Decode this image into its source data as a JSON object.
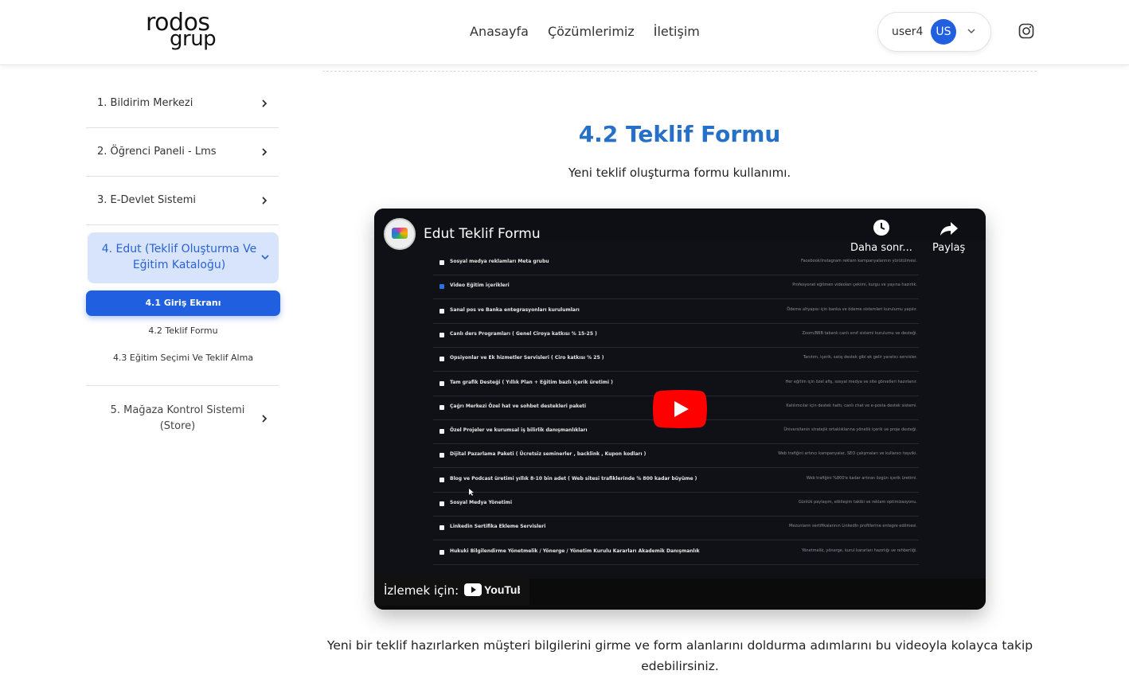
{
  "header": {
    "logo_line1": "rodos",
    "logo_line2": "grup",
    "nav": [
      "Anasayfa",
      "Çözümlerimiz",
      "İletişim"
    ],
    "user": {
      "name": "user4",
      "initials": "US"
    }
  },
  "sidebar": {
    "items": [
      {
        "label": "1. Bildirim Merkezi"
      },
      {
        "label": "2. Öğrenci Paneli - Lms"
      },
      {
        "label": "3. E-Devlet Sistemi"
      }
    ],
    "active": {
      "label": "4. Edut (Teklif Oluşturma Ve Eğitim Kataloğu)"
    },
    "subitems": [
      "4.1 Giriş Ekranı",
      "4.2 Teklif Formu",
      "4.3 Eğitim Seçimi Ve Teklif Alma"
    ],
    "last": {
      "label": "5. Mağaza Kontrol Sistemi (Store)"
    }
  },
  "main": {
    "title": "4.2 Teklif Formu",
    "subtitle": "Yeni teklif oluşturma formu kullanımı.",
    "description": "Yeni bir teklif hazırlarken müşteri bilgilerini girme ve form alanlarını doldurma adımlarını bu videoyla kolayca takip edebilirsiniz."
  },
  "video": {
    "title": "Edut Teklif Formu",
    "watch_later": "Daha sonr...",
    "share": "Paylaş",
    "watch_on": "İzlemek için:",
    "rows": [
      {
        "label": "Sosyal medya reklamları Meta grubu",
        "note": "Facebook/Instagram reklam kampanyalarının yürütülmesi.",
        "checked": false
      },
      {
        "label": "Video Eğitim içerikleri",
        "note": "Profesyonel eğitmen videoları çekimi, kurgu ve yayına hazırlık.",
        "checked": true
      },
      {
        "label": "Sanal pos ve Banka entegrasyonları kurulumları",
        "note": "Ödeme altyapısı için banka ve ödeme sistemleri kurulumu yapılır.",
        "checked": false
      },
      {
        "label": "Canlı ders Programları ( Genel Ciroya katkısı % 15-25 )",
        "note": "Zoom/BBB tabanlı canlı sınıf sistemi kurulumu ve desteği.",
        "checked": false
      },
      {
        "label": "Opsiyonlar ve Ek hizmetler Servisleri ( Ciro katkısı % 25 )",
        "note": "Tanıtım, içerik, satış destek gibi ek gelir yaratıcı servisler.",
        "checked": false
      },
      {
        "label": "Tam grafik Desteği ( Yıllık Plan + Eğitim bazlı içerik üretimi )",
        "note": "Her eğitim için özel afiş, sosyal medya ve site görselleri hazırlanır.",
        "checked": false
      },
      {
        "label": "Çağrı Merkezi Özel hat ve sohbet destekleri paketi",
        "note": "Katılımcılar için destek hattı, canlı chat ve e-posta destek sistemi.",
        "checked": false
      },
      {
        "label": "Özel Projeler ve kurumsal iş bilirlik danışmanlıkları",
        "note": "Üniversitenin stratejik ortaklıklarına yönelik içerik ve proje desteği.",
        "checked": false
      },
      {
        "label": "Dijital Pazarlama Paketi ( Ücretsiz seminerler , backlink , Kupon kodları )",
        "note": "Web trafiğini artırıcı kampanyalar, SEO çalışmaları ve kullanıcı teşviki.",
        "checked": false
      },
      {
        "label": "Blog ve Podcast üretimi yıllık 8-10 bin adet ( Web sitesi trafiklerinde % 800 kadar büyüme )",
        "note": "Web trafiğini %800'e kadar artıran özgün içerik üretimi.",
        "checked": false
      },
      {
        "label": "Sosyal Medya Yönetimi",
        "note": "Günlük paylaşım, etkileşim takibi ve reklam optimizasyonu.",
        "checked": false
      },
      {
        "label": "Linkedin Sertifika Ekleme Servisleri",
        "note": "Mezunların sertifikalarının LinkedIn profillerine entegre edilmesi.",
        "checked": false
      },
      {
        "label": "Hukuki Bilgilendirme Yönetmelik / Yönerge / Yönetim Kurulu Kararları Akademik Danışmanlık",
        "note": "Yönetmelik, yönerge, kurul kararları hazırlığı ve rehberliği.",
        "checked": false
      }
    ]
  },
  "colors": {
    "accent": "#1f5fe0",
    "title": "#2670c8",
    "active_bg": "#d7e4fb",
    "youtube_red": "#ff0000"
  }
}
